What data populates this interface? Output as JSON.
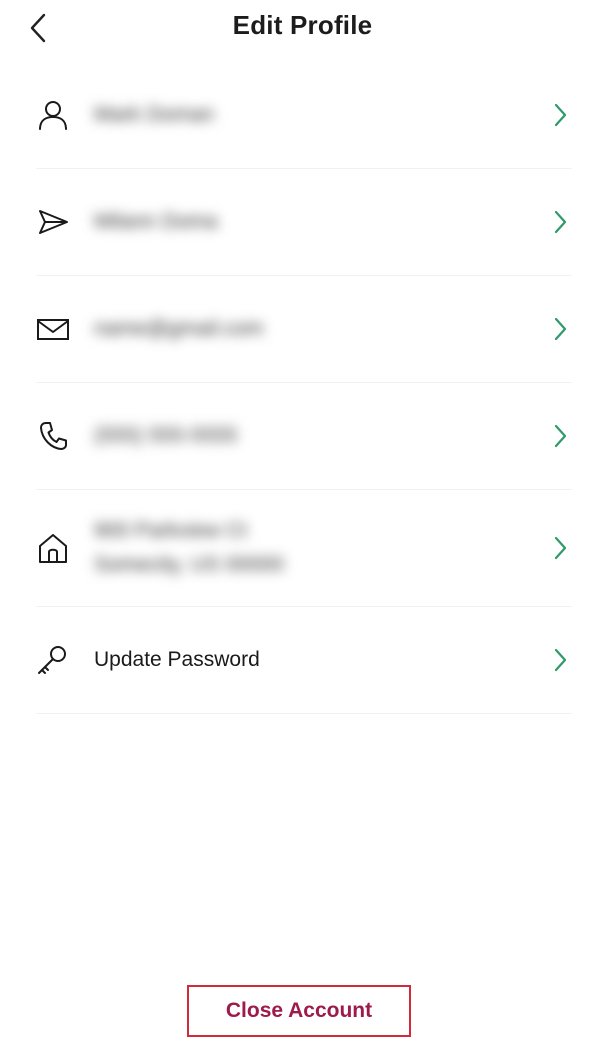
{
  "header": {
    "title": "Edit Profile",
    "back_icon": "chevron-left-icon"
  },
  "colors": {
    "chevron": "#2e9a6a",
    "close_account_text": "#9e1a4a",
    "close_account_border": "#d12a3a"
  },
  "rows": [
    {
      "icon": "person-icon",
      "lines": [
        "Mark Doman"
      ]
    },
    {
      "icon": "send-icon",
      "lines": [
        "Milann Doma"
      ]
    },
    {
      "icon": "mail-icon",
      "lines": [
        "name@gmail.com"
      ]
    },
    {
      "icon": "phone-icon",
      "lines": [
        "(555) 555-5555"
      ]
    },
    {
      "icon": "home-icon",
      "lines": [
        "900 Parkview Ct",
        "Somecity, US 00000"
      ]
    },
    {
      "icon": "key-icon",
      "lines": [
        "Update Password"
      ]
    }
  ],
  "footer": {
    "close_account_label": "Close Account"
  }
}
